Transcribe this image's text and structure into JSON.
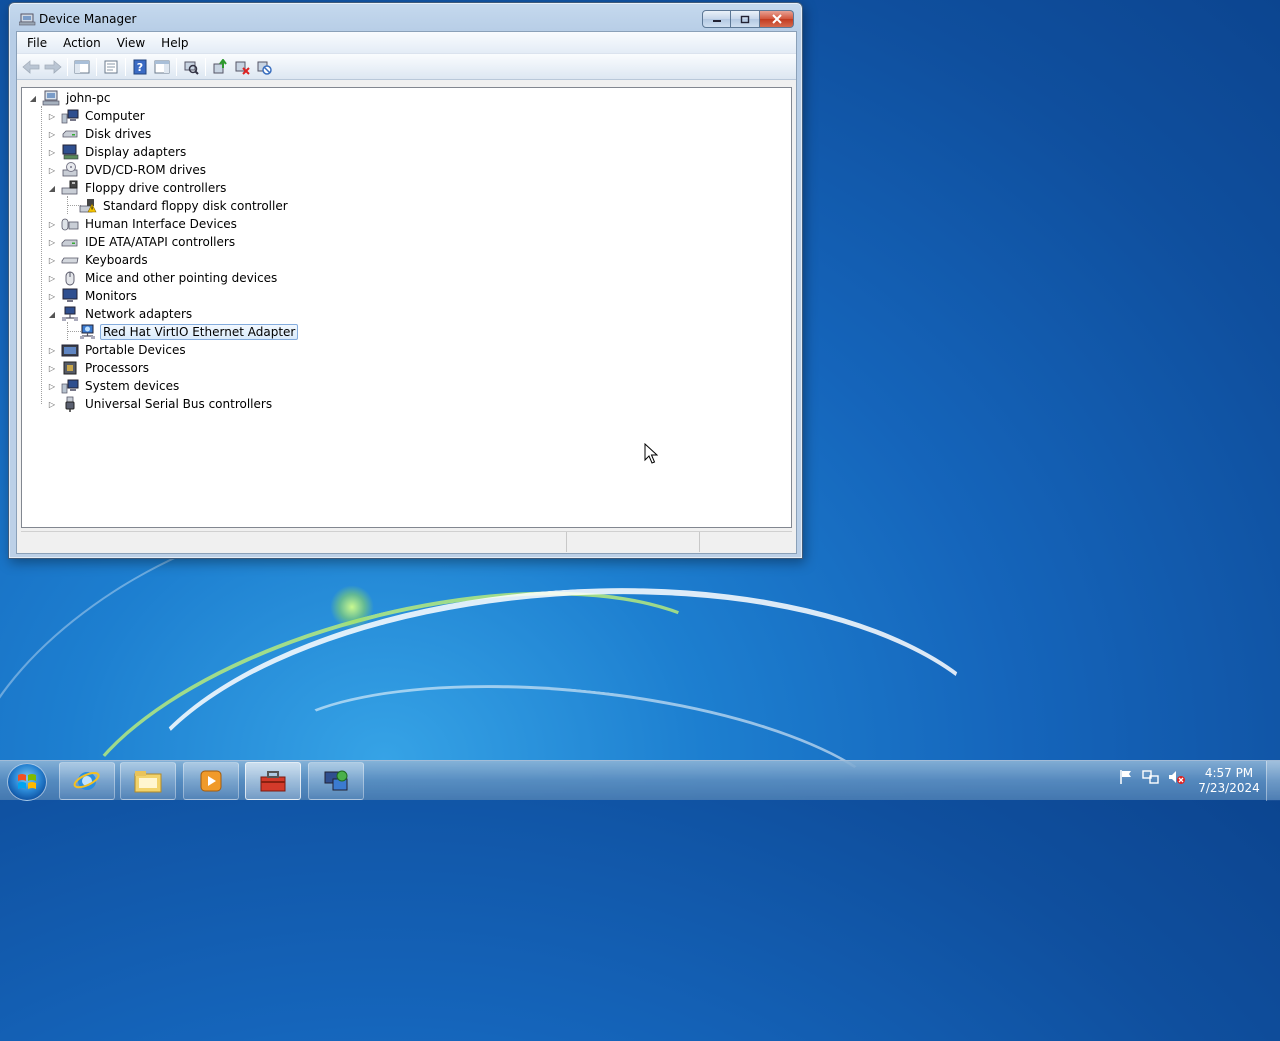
{
  "window": {
    "title": "Device Manager",
    "controls": {
      "minimize": "minimize",
      "maximize": "maximize",
      "close": "close"
    }
  },
  "menu": [
    "File",
    "Action",
    "View",
    "Help"
  ],
  "toolbar": [
    {
      "icon": "back-arrow-icon",
      "enabled": false
    },
    {
      "icon": "forward-arrow-icon",
      "enabled": false
    },
    {
      "icon": "show-hide-console-tree-icon",
      "enabled": true
    },
    {
      "icon": "properties-icon",
      "enabled": true
    },
    {
      "icon": "help-icon",
      "enabled": true
    },
    {
      "icon": "show-action-pane-icon",
      "enabled": true
    },
    {
      "icon": "scan-hardware-icon",
      "enabled": true
    },
    {
      "icon": "update-driver-icon",
      "enabled": true
    },
    {
      "icon": "uninstall-icon",
      "enabled": true
    },
    {
      "icon": "disable-device-icon",
      "enabled": true
    }
  ],
  "tree": {
    "root": "john-pc",
    "nodes": [
      {
        "label": "Computer",
        "icon": "computer-icon",
        "expanded": false
      },
      {
        "label": "Disk drives",
        "icon": "disk-drive-icon",
        "expanded": false
      },
      {
        "label": "Display adapters",
        "icon": "display-adapter-icon",
        "expanded": false
      },
      {
        "label": "DVD/CD-ROM drives",
        "icon": "dvd-drive-icon",
        "expanded": false
      },
      {
        "label": "Floppy drive controllers",
        "icon": "floppy-controller-icon",
        "expanded": true,
        "children": [
          {
            "label": "Standard floppy disk controller",
            "icon": "floppy-controller-warning-icon"
          }
        ]
      },
      {
        "label": "Human Interface Devices",
        "icon": "hid-icon",
        "expanded": false
      },
      {
        "label": "IDE ATA/ATAPI controllers",
        "icon": "ide-controller-icon",
        "expanded": false
      },
      {
        "label": "Keyboards",
        "icon": "keyboard-icon",
        "expanded": false
      },
      {
        "label": "Mice and other pointing devices",
        "icon": "mouse-icon",
        "expanded": false
      },
      {
        "label": "Monitors",
        "icon": "monitor-icon",
        "expanded": false
      },
      {
        "label": "Network adapters",
        "icon": "network-adapter-icon",
        "expanded": true,
        "children": [
          {
            "label": "Red Hat VirtIO Ethernet Adapter",
            "icon": "network-adapter-icon",
            "selected": true
          }
        ]
      },
      {
        "label": "Portable Devices",
        "icon": "portable-device-icon",
        "expanded": false
      },
      {
        "label": "Processors",
        "icon": "processor-icon",
        "expanded": false
      },
      {
        "label": "System devices",
        "icon": "system-devices-icon",
        "expanded": false
      },
      {
        "label": "Universal Serial Bus controllers",
        "icon": "usb-icon",
        "expanded": false
      }
    ]
  },
  "taskbar": {
    "items": [
      {
        "icon": "internet-explorer-icon",
        "active": false
      },
      {
        "icon": "file-explorer-icon",
        "active": false
      },
      {
        "icon": "media-player-icon",
        "active": false
      },
      {
        "icon": "toolbox-icon",
        "active": true
      },
      {
        "icon": "network-sharing-icon",
        "active": false
      }
    ],
    "tray": [
      "action-center-flag-icon",
      "network-icon",
      "volume-muted-icon"
    ],
    "clock": {
      "time": "4:57 PM",
      "date": "7/23/2024"
    }
  },
  "colors": {
    "selection_border": "#84acdd",
    "selection_fill": "#d9ebfb",
    "close_button": "#c23b20"
  }
}
